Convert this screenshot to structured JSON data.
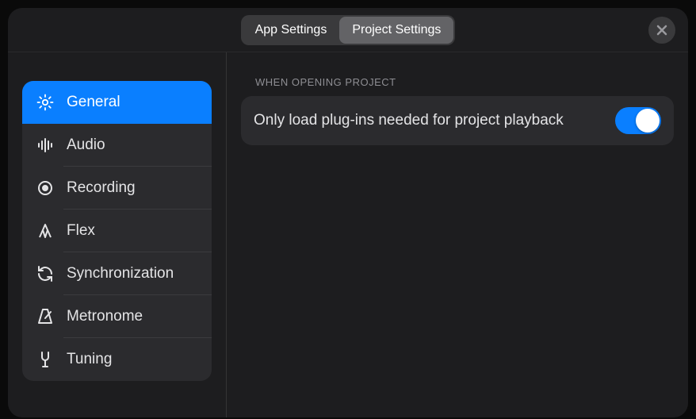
{
  "header": {
    "tabs": [
      "App Settings",
      "Project Settings"
    ],
    "active_tab": 1
  },
  "sidebar": {
    "items": [
      {
        "id": "general",
        "label": "General",
        "icon": "gear-icon"
      },
      {
        "id": "audio",
        "label": "Audio",
        "icon": "waveform-icon"
      },
      {
        "id": "recording",
        "label": "Recording",
        "icon": "record-icon"
      },
      {
        "id": "flex",
        "label": "Flex",
        "icon": "flex-icon"
      },
      {
        "id": "synchronization",
        "label": "Synchronization",
        "icon": "sync-icon"
      },
      {
        "id": "metronome",
        "label": "Metronome",
        "icon": "metronome-icon"
      },
      {
        "id": "tuning",
        "label": "Tuning",
        "icon": "tuning-fork-icon"
      }
    ],
    "selected": "general"
  },
  "content": {
    "section_title": "WHEN OPENING PROJECT",
    "setting_label": "Only load plug-ins needed for project playback",
    "setting_enabled": true
  }
}
